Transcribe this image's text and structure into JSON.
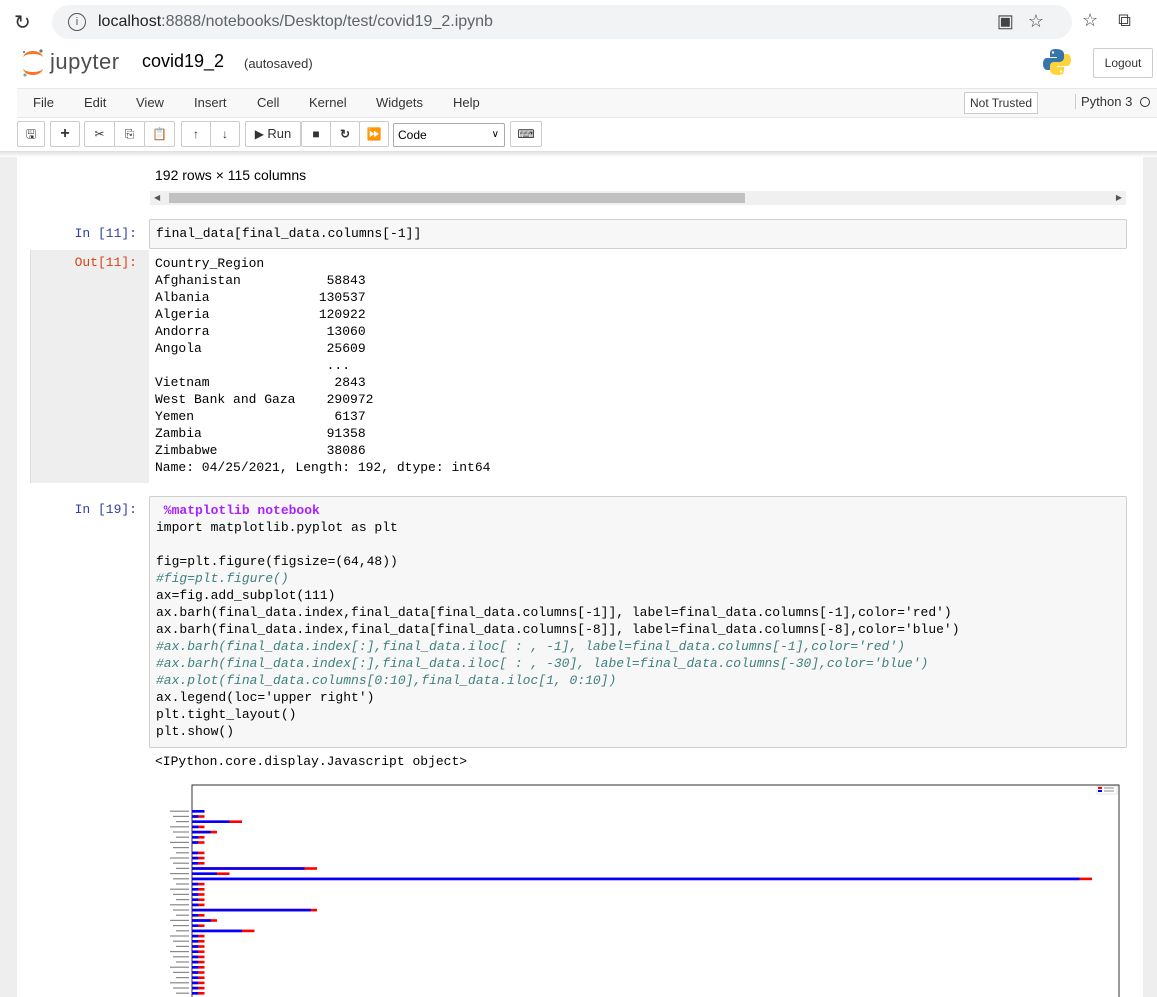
{
  "browser": {
    "host": "localhost",
    "path": ":8888/notebooks/Desktop/test/covid19_2.ipynb"
  },
  "header": {
    "logo_text": "jupyter",
    "notebook_name": "covid19_2",
    "autosave_status": "(autosaved)",
    "logout_label": "Logout"
  },
  "menu": {
    "items": [
      "File",
      "Edit",
      "View",
      "Insert",
      "Cell",
      "Kernel",
      "Widgets",
      "Help"
    ],
    "trust_label": "Not Trusted",
    "kernel_name": "Python 3"
  },
  "toolbar": {
    "run_label": "Run",
    "cell_type": "Code"
  },
  "output_prev": {
    "rows_info": "192 rows × 115 columns"
  },
  "cell11": {
    "in_prompt": "In [11]:",
    "out_prompt": "Out[11]:",
    "code": "final_data[final_data.columns[-1]]",
    "output": "Country_Region\nAfghanistan           58843\nAlbania              130537\nAlgeria              120922\nAndorra               13060\nAngola                25609\n                      ...  \nVietnam                2843\nWest Bank and Gaza    290972\nYemen                  6137\nZambia                91358\nZimbabwe              38086\nName: 04/25/2021, Length: 192, dtype: int64"
  },
  "cell19": {
    "in_prompt": "In [19]:",
    "js_output": "<IPython.core.display.Javascript object>",
    "lines": {
      "l1": " %matplotlib notebook",
      "l2": "import matplotlib.pyplot as plt",
      "l3": "fig=plt.figure(figsize=(64,48))",
      "l4": "#fig=plt.figure()",
      "l5": "ax=fig.add_subplot(111)",
      "l6": "ax.barh(final_data.index,final_data[final_data.columns[-1]], label=final_data.columns[-1],color='red')",
      "l7": "ax.barh(final_data.index,final_data[final_data.columns[-8]], label=final_data.columns[-8],color='blue')",
      "l8": "#ax.barh(final_data.index[:],final_data.iloc[ : , -1], label=final_data.columns[-1],color='red')",
      "l9": "#ax.barh(final_data.index[:],final_data.iloc[ : , -30], label=final_data.columns[-30],color='blue')",
      "l10": "#ax.plot(final_data.columns[0:10],final_data.iloc[1, 0:10])",
      "l11": "ax.legend(loc='upper right')",
      "l12": "plt.tight_layout()",
      "l13": "plt.show()"
    }
  },
  "colors": {
    "accent_orange": "#f37726",
    "in_prompt": "#303f9f",
    "out_prompt": "#d84315",
    "series_red": "#ff0000",
    "series_blue": "#0000ff"
  },
  "chart_data": {
    "type": "bar",
    "orientation": "horizontal",
    "series": [
      {
        "color": "red",
        "values": [
          1,
          1,
          4,
          1,
          2,
          1,
          1,
          0,
          1,
          1,
          1,
          10,
          3,
          72,
          1,
          1,
          1,
          1,
          1,
          10,
          1,
          2,
          1,
          5,
          1,
          1,
          1,
          1,
          1,
          1,
          1,
          1,
          1,
          1,
          1,
          1,
          1,
          1,
          1,
          8
        ]
      },
      {
        "color": "blue",
        "values": [
          1,
          0.5,
          3,
          0.5,
          1.5,
          0.5,
          0.5,
          0,
          0.5,
          0.5,
          0.5,
          9,
          2,
          71,
          0.5,
          0.5,
          0.5,
          0.5,
          0.5,
          9.5,
          0.5,
          1.5,
          0.5,
          4,
          0.5,
          0.5,
          0.5,
          0.5,
          0.5,
          0.5,
          0.5,
          0.5,
          0.5,
          0.5,
          0.5,
          0.5,
          0.5,
          0.5,
          0.5,
          7.5
        ]
      }
    ]
  }
}
